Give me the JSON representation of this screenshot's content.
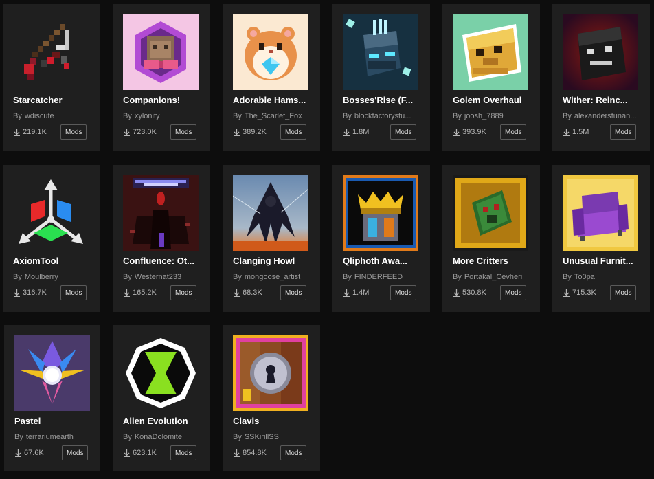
{
  "by_label": "By",
  "mods": [
    {
      "title": "Starcatcher",
      "author": "wdiscute",
      "downloads": "219.1K",
      "tag": "Mods"
    },
    {
      "title": "Companions!",
      "author": "xylonity",
      "downloads": "723.0K",
      "tag": "Mods"
    },
    {
      "title": "Adorable Hams...",
      "author": "The_Scarlet_Fox",
      "downloads": "389.2K",
      "tag": "Mods"
    },
    {
      "title": "Bosses'Rise (F...",
      "author": "blockfactorystu...",
      "downloads": "1.8M",
      "tag": "Mods"
    },
    {
      "title": "Golem Overhaul",
      "author": "joosh_7889",
      "downloads": "393.9K",
      "tag": "Mods"
    },
    {
      "title": "Wither: Reinc...",
      "author": "alexandersfunan...",
      "downloads": "1.5M",
      "tag": "Mods"
    },
    {
      "title": "AxiomTool",
      "author": "Moulberry",
      "downloads": "316.7K",
      "tag": "Mods"
    },
    {
      "title": "Confluence: Ot...",
      "author": "Westernat233",
      "downloads": "165.2K",
      "tag": "Mods"
    },
    {
      "title": "Clanging Howl",
      "author": "mongoose_artist",
      "downloads": "68.3K",
      "tag": "Mods"
    },
    {
      "title": "Qliphoth Awa...",
      "author": "FINDERFEED",
      "downloads": "1.4M",
      "tag": "Mods"
    },
    {
      "title": "More Critters",
      "author": "Portakal_Cevheri",
      "downloads": "530.8K",
      "tag": "Mods"
    },
    {
      "title": "Unusual Furnit...",
      "author": "To0pa",
      "downloads": "715.3K",
      "tag": "Mods"
    },
    {
      "title": "Pastel",
      "author": "terrariumearth",
      "downloads": "67.6K",
      "tag": "Mods"
    },
    {
      "title": "Alien Evolution",
      "author": "KonaDolomite",
      "downloads": "623.1K",
      "tag": "Mods"
    },
    {
      "title": "Clavis",
      "author": "SSKirillSS",
      "downloads": "854.8K",
      "tag": "Mods"
    }
  ]
}
